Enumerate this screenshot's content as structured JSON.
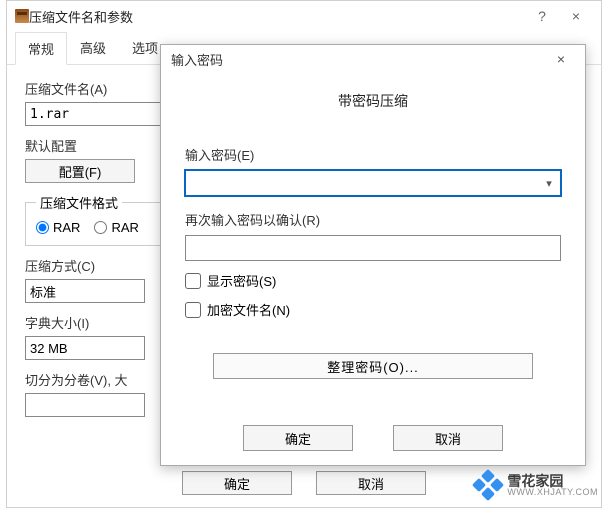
{
  "parent": {
    "title": "压缩文件名和参数",
    "help": "?",
    "close": "×",
    "tabs": [
      "常规",
      "高级",
      "选项"
    ],
    "archive_name_label": "压缩文件名(A)",
    "archive_name_value": "1.rar",
    "default_profile_label": "默认配置",
    "profiles_btn": "配置(F)",
    "format_group": "压缩文件格式",
    "format_rar": "RAR",
    "format_rar5": "RAR",
    "method_label": "压缩方式(C)",
    "method_value": "标准",
    "dict_label": "字典大小(I)",
    "dict_value": "32 MB",
    "split_label": "切分为分卷(V), 大",
    "ok": "确定",
    "cancel": "取消"
  },
  "modal": {
    "title": "输入密码",
    "heading": "带密码压缩",
    "pwd_label": "输入密码(E)",
    "pwd_value": "",
    "confirm_label": "再次输入密码以确认(R)",
    "confirm_value": "",
    "show_pwd": "显示密码(S)",
    "encrypt_names": "加密文件名(N)",
    "organize": "整理密码(O)...",
    "ok": "确定",
    "cancel": "取消",
    "close": "×"
  },
  "watermark": {
    "name": "雪花家园",
    "url": "WWW.XHJATY.COM"
  }
}
